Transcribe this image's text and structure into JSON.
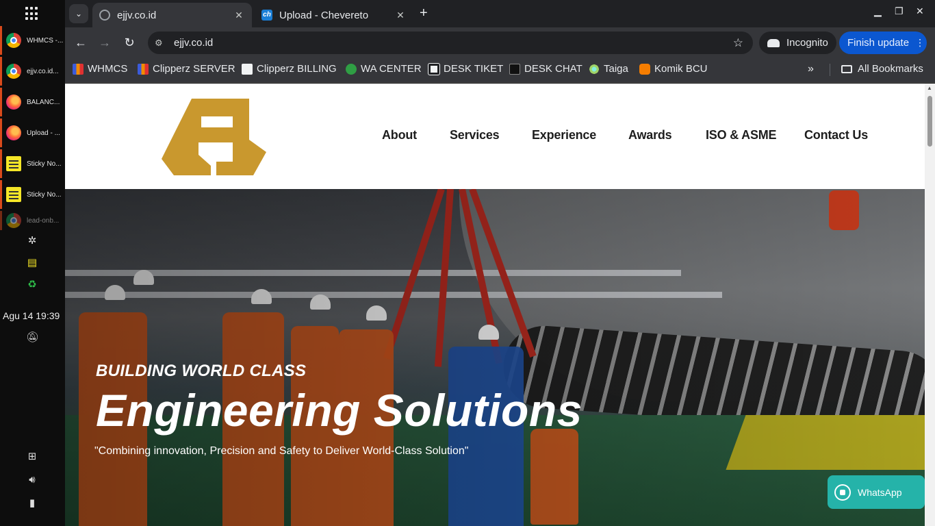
{
  "desktop": {
    "tasks": [
      {
        "label": "WHMCS -...",
        "icon": "chrome-icon"
      },
      {
        "label": "ejjv.co.id...",
        "icon": "chrome-icon"
      },
      {
        "label": "BALANC...",
        "icon": "firefox-icon"
      },
      {
        "label": "Upload - ...",
        "icon": "firefox-icon"
      },
      {
        "label": "Sticky No...",
        "icon": "sticky-notes-icon"
      },
      {
        "label": "Sticky No...",
        "icon": "sticky-notes-icon"
      },
      {
        "label": "lead-onb...",
        "icon": "chrome-icon"
      }
    ],
    "clock": "Agu 14  19:39"
  },
  "browser": {
    "tabs": [
      {
        "title": "ejjv.co.id",
        "active": true
      },
      {
        "title": "Upload - Chevereto",
        "active": false
      }
    ],
    "address": "ejjv.co.id",
    "incognito_label": "Incognito",
    "finish_update_label": "Finish update",
    "bookmarks": [
      {
        "label": "WHMCS"
      },
      {
        "label": "Clipperz SERVER"
      },
      {
        "label": "Clipperz BILLING"
      },
      {
        "label": "WA CENTER"
      },
      {
        "label": "DESK TIKET"
      },
      {
        "label": "DESK CHAT"
      },
      {
        "label": "Taiga"
      },
      {
        "label": "Komik BCU"
      }
    ],
    "all_bookmarks_label": "All Bookmarks"
  },
  "site": {
    "nav": [
      "About",
      "Services",
      "Experience",
      "Awards",
      "ISO & ASME",
      "Contact Us"
    ],
    "logo_color": "#c9982e",
    "hero": {
      "kicker": "BUILDING WORLD CLASS",
      "title": "Engineering Solutions",
      "subtitle": "\"Combining innovation, Precision and Safety to Deliver World-Class Solution\""
    },
    "whatsapp_label": "WhatsApp",
    "whatsapp_color": "#25b3a9"
  }
}
